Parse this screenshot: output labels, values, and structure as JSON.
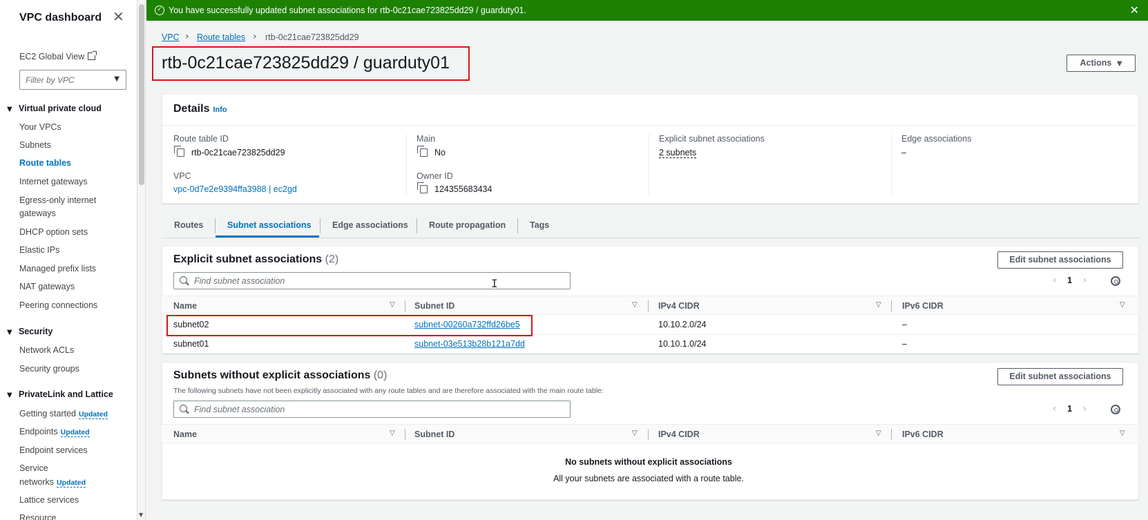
{
  "sidebar": {
    "title": "VPC dashboard",
    "ec2_global_view": "EC2 Global View",
    "filter_placeholder": "Filter by VPC",
    "sections": [
      {
        "title": "Virtual private cloud",
        "items": [
          "Your VPCs",
          "Subnets",
          "Route tables",
          "Internet gateways",
          "Egress-only internet",
          "gateways",
          "DHCP option sets",
          "Elastic IPs",
          "Managed prefix lists",
          "NAT gateways",
          "Peering connections"
        ]
      },
      {
        "title": "Security",
        "items": [
          "Network ACLs",
          "Security groups"
        ]
      },
      {
        "title": "PrivateLink and Lattice",
        "items": [
          "Getting started",
          "Endpoints",
          "Endpoint services",
          "Service",
          "networks",
          "Lattice services",
          "Resource"
        ]
      }
    ],
    "updated_badge": "Updated",
    "active_item": "Route tables"
  },
  "flash": {
    "message": "You have successfully updated subnet associations for rtb-0c21cae723825dd29 / guarduty01."
  },
  "breadcrumb": [
    "VPC",
    "Route tables",
    "rtb-0c21cae723825dd29"
  ],
  "page_title": "rtb-0c21cae723825dd29 / guarduty01",
  "actions_button": "Actions",
  "details": {
    "title": "Details",
    "info": "Info",
    "route_table_id_label": "Route table ID",
    "route_table_id": "rtb-0c21cae723825dd29",
    "main_label": "Main",
    "main": "No",
    "explicit_label": "Explicit subnet associations",
    "explicit": "2 subnets",
    "edge_label": "Edge associations",
    "edge": "–",
    "vpc_label": "VPC",
    "vpc": "vpc-0d7e2e9394ffa3988 | ec2gd",
    "owner_label": "Owner ID",
    "owner": "124355683434"
  },
  "tabs": [
    "Routes",
    "Subnet associations",
    "Edge associations",
    "Route propagation",
    "Tags"
  ],
  "explicit_panel": {
    "title": "Explicit subnet associations",
    "count": "(2)",
    "edit_button": "Edit subnet associations",
    "search_placeholder": "Find subnet association",
    "page": "1",
    "columns": [
      "Name",
      "Subnet ID",
      "IPv4 CIDR",
      "IPv6 CIDR"
    ],
    "rows": [
      {
        "name": "subnet02",
        "subnet_id": "subnet-00260a732ffd26be5",
        "ipv4": "10.10.2.0/24",
        "ipv6": "–"
      },
      {
        "name": "subnet01",
        "subnet_id": "subnet-03e513b28b121a7dd",
        "ipv4": "10.10.1.0/24",
        "ipv6": "–"
      }
    ]
  },
  "nonexplicit_panel": {
    "title": "Subnets without explicit associations",
    "count": "(0)",
    "description": "The following subnets have not been explicitly associated with any route tables and are therefore associated with the main route table:",
    "edit_button": "Edit subnet associations",
    "search_placeholder": "Find subnet association",
    "page": "1",
    "columns": [
      "Name",
      "Subnet ID",
      "IPv4 CIDR",
      "IPv6 CIDR"
    ],
    "empty_title": "No subnets without explicit associations",
    "empty_sub": "All your subnets are associated with a route table."
  },
  "colors": {
    "flash": "#1d8102",
    "link": "#0073bb",
    "highlight": "#d91515"
  }
}
